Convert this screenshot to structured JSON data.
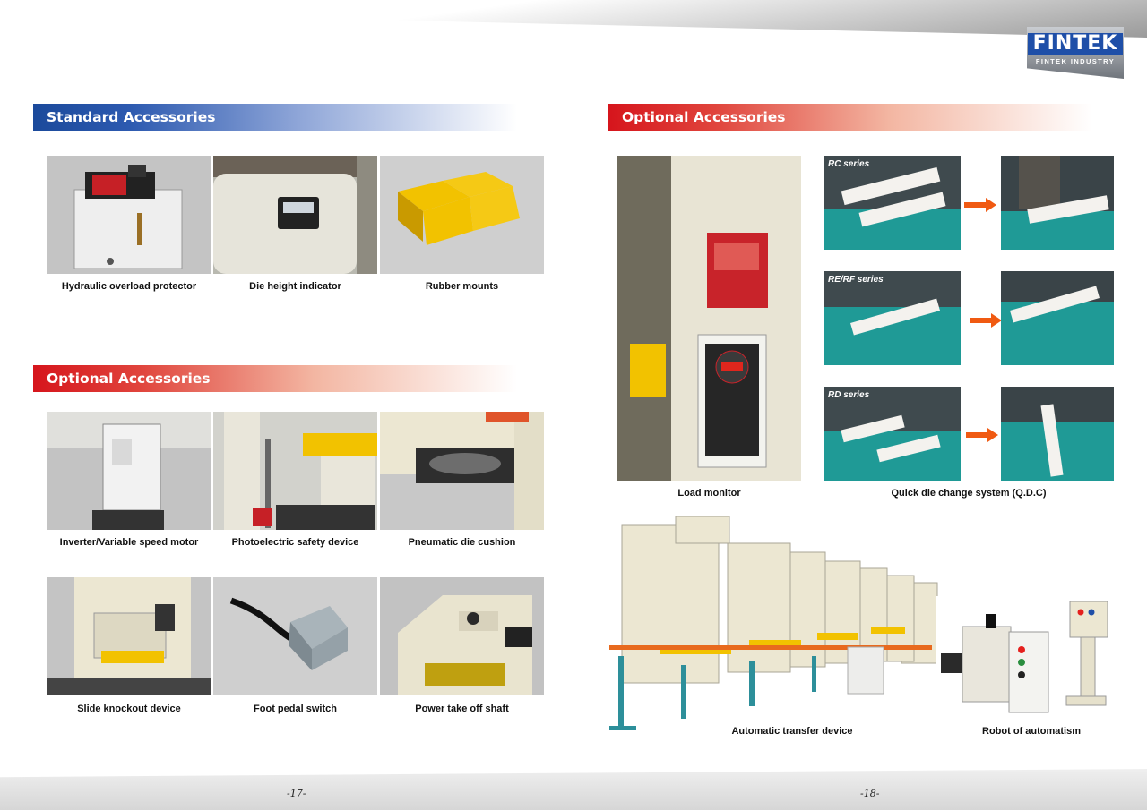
{
  "brand": {
    "name": "FINTEK",
    "subtitle": "FINTEK INDUSTRY"
  },
  "left_page": {
    "standard_header": "Standard Accessories",
    "optional_header": "Optional Accessories",
    "standard_items": [
      {
        "label": "Hydraulic overload protector"
      },
      {
        "label": "Die height indicator"
      },
      {
        "label": "Rubber mounts"
      }
    ],
    "optional_items": [
      {
        "label": "Inverter/Variable speed motor"
      },
      {
        "label": "Photoelectric safety device"
      },
      {
        "label": "Pneumatic die cushion"
      },
      {
        "label": "Slide knockout device"
      },
      {
        "label": "Foot pedal switch"
      },
      {
        "label": "Power take off shaft"
      }
    ],
    "page_number": "-17-"
  },
  "right_page": {
    "optional_header": "Optional Accessories",
    "load_monitor": "Load monitor",
    "qdc": "Quick die change system (Q.D.C)",
    "series": [
      "RC series",
      "RE/RF series",
      "RD series"
    ],
    "transfer": "Automatic transfer device",
    "robot": "Robot of automatism",
    "page_number": "-18-"
  },
  "colors": {
    "accent_blue": "#1b4a9b",
    "accent_red": "#d6151c",
    "machine_yellow": "#f2c200",
    "machine_cream": "#ece7d2"
  }
}
